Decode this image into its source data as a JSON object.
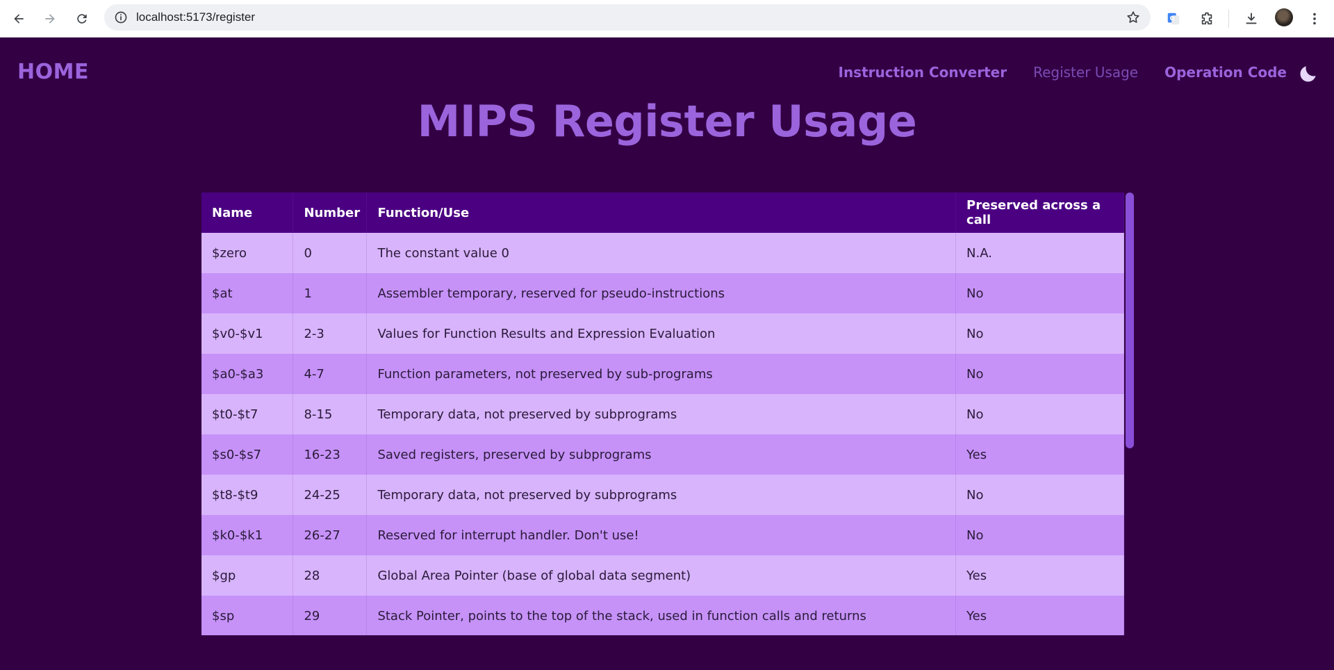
{
  "browser": {
    "url": "localhost:5173/register"
  },
  "app": {
    "home_label": "HOME",
    "nav": [
      {
        "label": "Instruction Converter",
        "active": false
      },
      {
        "label": "Register Usage",
        "active": true
      },
      {
        "label": "Operation Code",
        "active": false
      }
    ],
    "theme_icon": "moon-icon"
  },
  "page": {
    "title": "MIPS Register Usage"
  },
  "table": {
    "headers": [
      "Name",
      "Number",
      "Function/Use",
      "Preserved across a call"
    ],
    "rows": [
      [
        "$zero",
        "0",
        "The constant value 0",
        "N.A."
      ],
      [
        "$at",
        "1",
        "Assembler temporary, reserved for pseudo-instructions",
        "No"
      ],
      [
        "$v0-$v1",
        "2-3",
        "Values for Function Results and Expression Evaluation",
        "No"
      ],
      [
        "$a0-$a3",
        "4-7",
        "Function parameters, not preserved by sub-programs",
        "No"
      ],
      [
        "$t0-$t7",
        "8-15",
        "Temporary data, not preserved by subprograms",
        "No"
      ],
      [
        "$s0-$s7",
        "16-23",
        "Saved registers, preserved by subprograms",
        "Yes"
      ],
      [
        "$t8-$t9",
        "24-25",
        "Temporary data, not preserved by subprograms",
        "No"
      ],
      [
        "$k0-$k1",
        "26-27",
        "Reserved for interrupt handler. Don't use!",
        "No"
      ],
      [
        "$gp",
        "28",
        "Global Area Pointer (base of global data segment)",
        "Yes"
      ],
      [
        "$sp",
        "29",
        "Stack Pointer, points to the top of the stack, used in function calls and returns",
        "Yes"
      ]
    ]
  },
  "colors": {
    "background": "#330044",
    "accent": "#9b64dc",
    "header_bg": "#4b0082",
    "row_light": "#d8b4fc",
    "row_dark": "#c692f8"
  }
}
